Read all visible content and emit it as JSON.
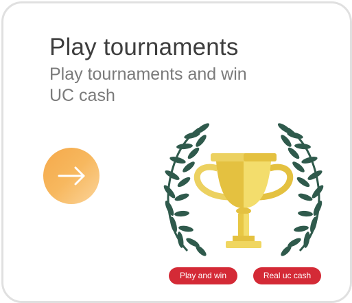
{
  "card": {
    "title": "Play tournaments",
    "subtitle": "Play tournaments and win UC cash",
    "action_icon": "arrow-right-icon",
    "illustration_icon": "trophy-laurel-icon"
  },
  "tags": [
    {
      "label": "Play and win"
    },
    {
      "label": "Real uc cash"
    }
  ],
  "colors": {
    "accent_orange": "#f5a94a",
    "trophy_gold": "#e8c744",
    "laurel_green": "#2f5a4c",
    "tag_red": "#d42a36"
  }
}
